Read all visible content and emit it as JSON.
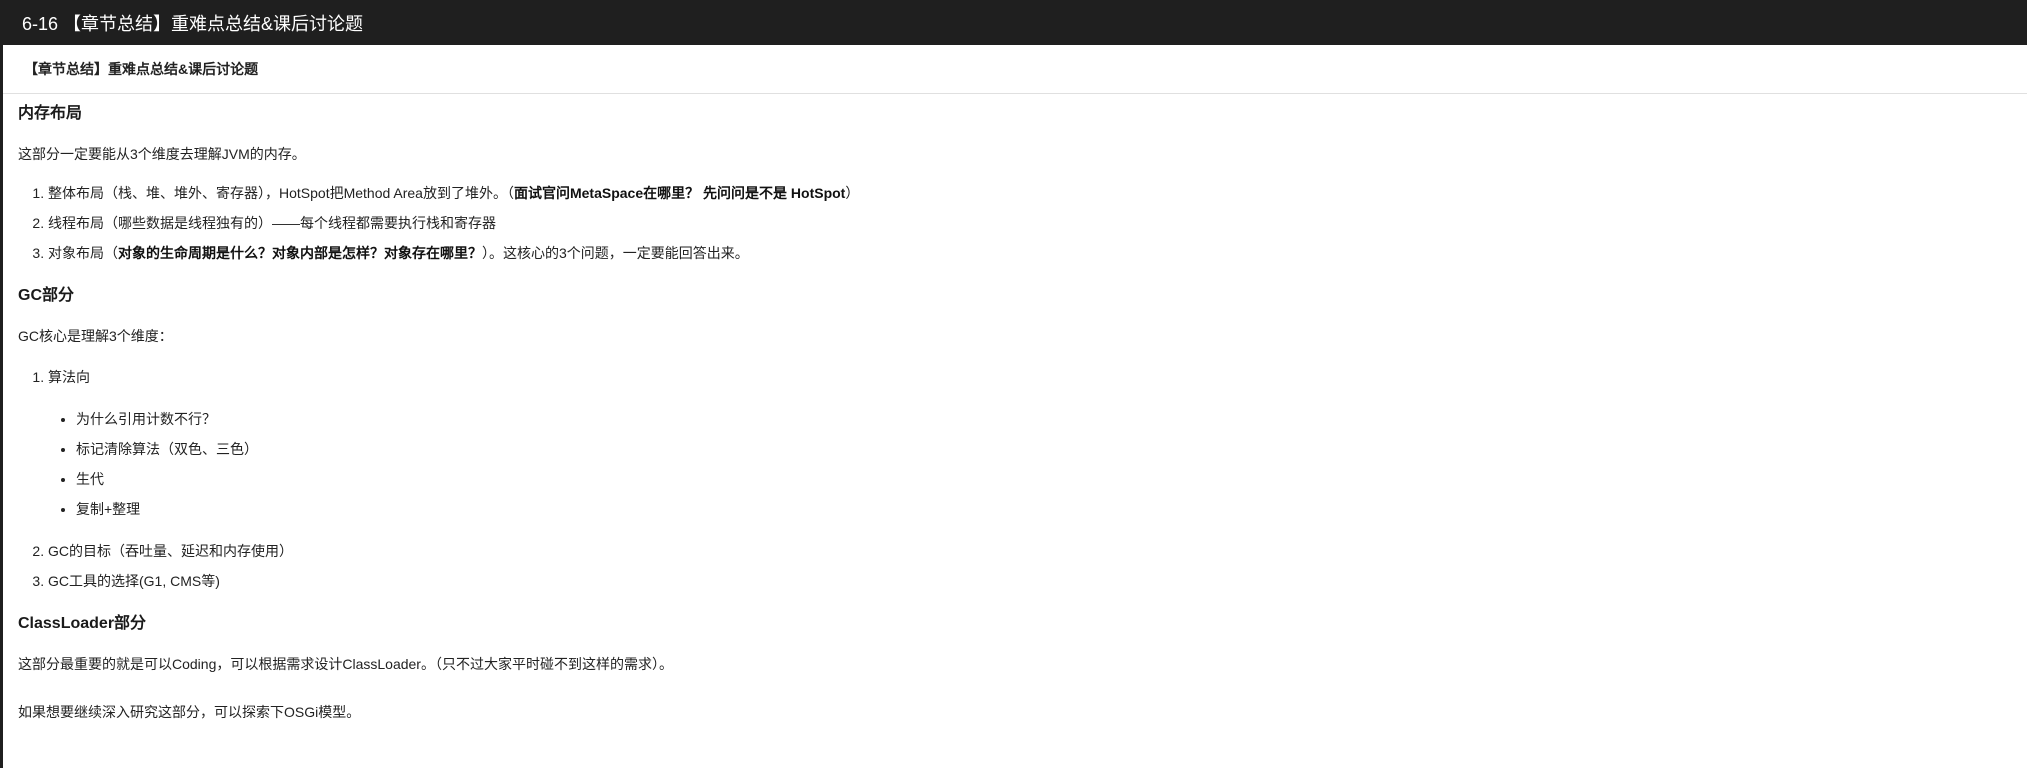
{
  "window": {
    "title": "6-16 【章节总结】重难点总结&课后讨论题"
  },
  "subheader": {
    "title": "【章节总结】重难点总结&课后讨论题"
  },
  "sections": {
    "memory": {
      "heading": "内存布局",
      "intro": "这部分一定要能从3个维度去理解JVM的内存。",
      "items": [
        {
          "prefix": "整体布局（栈、堆、堆外、寄存器），HotSpot把Method Area放到了堆外。（",
          "bold": "面试官问MetaSpace在哪里？ 先问问是不是 HotSpot",
          "suffix": "）"
        },
        {
          "prefix": "线程布局（哪些数据是线程独有的）——每个线程都需要执行栈和寄存器",
          "bold": "",
          "suffix": ""
        },
        {
          "prefix": "对象布局（",
          "bold": "对象的生命周期是什么？对象内部是怎样？对象存在哪里？",
          "suffix": "）。这核心的3个问题，一定要能回答出来。"
        }
      ]
    },
    "gc": {
      "heading": "GC部分",
      "intro": "GC核心是理解3个维度：",
      "item1": "算法向",
      "subitems": [
        "为什么引用计数不行？",
        "标记清除算法（双色、三色）",
        "生代",
        "复制+整理"
      ],
      "item2": "GC的目标（吞吐量、延迟和内存使用）",
      "item3": "GC工具的选择(G1, CMS等)"
    },
    "classloader": {
      "heading": "ClassLoader部分",
      "p1": "这部分最重要的就是可以Coding，可以根据需求设计ClassLoader。（只不过大家平时碰不到这样的需求）。",
      "p2": "如果想要继续深入研究这部分，可以探索下OSGi模型。"
    }
  }
}
